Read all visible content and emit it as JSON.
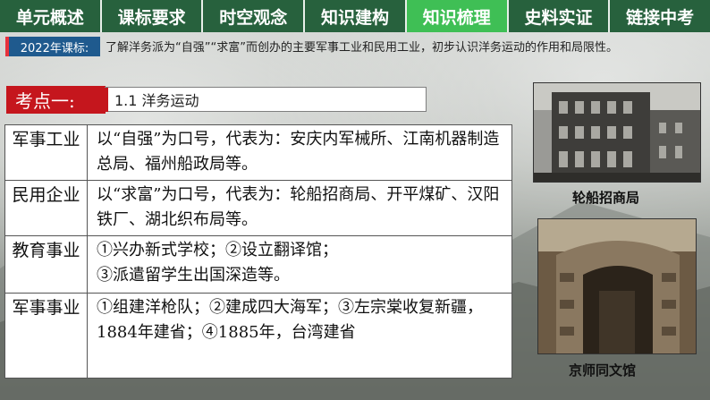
{
  "nav": {
    "items": [
      {
        "label": "单元概述",
        "active": false
      },
      {
        "label": "课标要求",
        "active": false
      },
      {
        "label": "时空观念",
        "active": false
      },
      {
        "label": "知识建构",
        "active": false
      },
      {
        "label": "知识梳理",
        "active": true
      },
      {
        "label": "史料实证",
        "active": false
      },
      {
        "label": "链接中考",
        "active": false
      }
    ]
  },
  "standard": {
    "badge": "2022年课标:",
    "text": "了解洋务派为“自强”“求富”而创办的主要军事工业和民用工业，初步认识洋务运动的作用和局限性。"
  },
  "key_point": {
    "badge": "考点一:",
    "title": "1.1 洋务运动"
  },
  "table": {
    "rows": [
      {
        "head": "军事工业",
        "body": "以“自强”为口号，代表为：安庆内军械所、江南机器制造总局、福州船政局等。"
      },
      {
        "head": "民用企业",
        "body": "以“求富”为口号，代表为：轮船招商局、开平煤矿、汉阳铁厂、湖北织布局等。"
      },
      {
        "head": "教育事业",
        "body_lines": [
          "①兴办新式学校；②设立翻译馆；",
          "③派遣留学生出国深造等。"
        ]
      },
      {
        "head": "军事事业",
        "body": "①组建洋枪队；②建成四大海军；③左宗棠收复新疆，1884年建省；④1885年，台湾建省"
      }
    ]
  },
  "photos": {
    "photo1_caption": "轮船招商局",
    "photo2_caption": "京师同文馆"
  },
  "colors": {
    "nav_bg": "#27613d",
    "nav_active": "#3fbf55",
    "badge_blue": "#1f5a8e",
    "badge_red": "#c5161d"
  }
}
